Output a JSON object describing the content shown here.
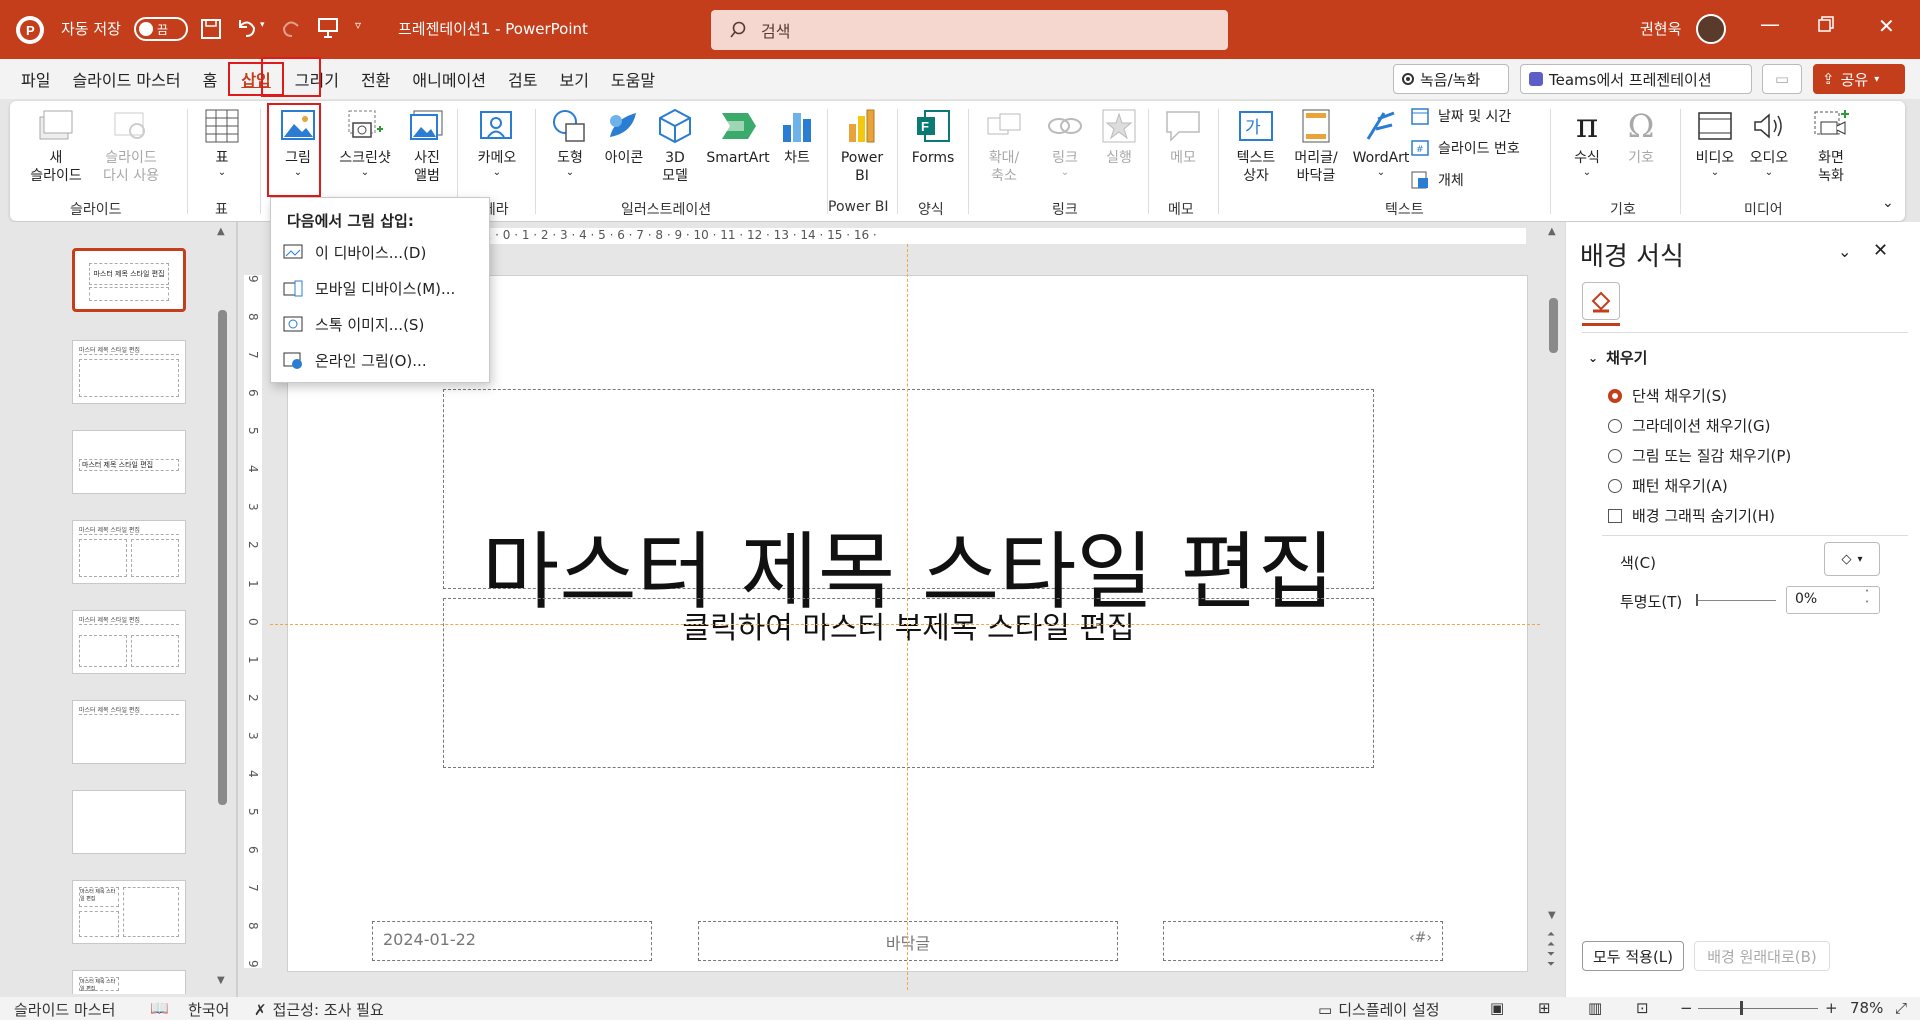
{
  "titlebar": {
    "autosave_label": "자동 저장",
    "autosave_state": "끔",
    "doc_title": "프레젠테이션1  -  PowerPoint",
    "search_placeholder": "검색",
    "user_name": "권현욱"
  },
  "menubar": {
    "items": [
      "파일",
      "슬라이드 마스터",
      "홈",
      "삽입",
      "그리기",
      "전환",
      "애니메이션",
      "검토",
      "보기",
      "도움말"
    ],
    "active": "삽입",
    "record_label": "녹음/녹화",
    "teams_label": "Teams에서 프레젠테이션",
    "share_label": "공유"
  },
  "ribbon": {
    "new_slide": "새\n슬라이드",
    "reuse_slide": "슬라이드\n다시 사용",
    "group_slide": "슬라이드",
    "table": "표",
    "group_table": "표",
    "picture": "그림",
    "screenshot": "스크린샷",
    "photo_album": "사진\n앨범",
    "cameo": "카메오",
    "group_camera": "카메라",
    "shapes": "도형",
    "icons": "아이콘",
    "model3d": "3D\n모델",
    "smartart": "SmartArt",
    "chart": "차트",
    "group_illustrations": "일러스트레이션",
    "powerbi": "Power\nBI",
    "group_powerbi": "Power BI",
    "forms": "Forms",
    "group_forms": "양식",
    "zoom": "확대/\n축소",
    "link": "링크",
    "action": "실행",
    "group_links": "링크",
    "comment": "메모",
    "group_comments": "메모",
    "textbox": "텍스트\n상자",
    "header_footer": "머리글/\n바닥글",
    "wordart": "WordArt",
    "date_time": "날짜 및 시간",
    "slide_number": "슬라이드 번호",
    "object": "개체",
    "group_text": "텍스트",
    "equation": "수식",
    "symbol": "기호",
    "group_symbols": "기호",
    "video": "비디오",
    "audio": "오디오",
    "screen_recording": "화면\n녹화",
    "group_media": "미디어"
  },
  "picture_menu": {
    "header": "다음에서 그림 삽입:",
    "items": [
      "이 디바이스...(D)",
      "모바일 디바이스(M)...",
      "스톡 이미지...(S)",
      "온라인 그림(O)..."
    ]
  },
  "thumbnails": {
    "t1": "마스터 제목 스타일 편집",
    "t2": "마스터 제목 스타일 편집",
    "t3": "마스터 제목 스타일 편집",
    "t4": "마스터 제목 스타일 편집",
    "t5": "마스터 제목 스타일 편집",
    "t6": "마스터 제목 스타일 편집",
    "t8": "마스터 제목 스타일 편집",
    "t9": "마스터 제목 스타일 편집"
  },
  "ruler": {
    "h": "· 11 · 10 · 9 · 8 · 7 · 6 · 5 · 4 · 3 · 2 · 1 · 0 · 1 · 2 · 3 · 4 · 5 · 6 · 7 · 8 · 9 · 10 · 11 · 12 · 13 · 14 · 15 · 16 ·",
    "v": [
      "9",
      "8",
      "7",
      "6",
      "5",
      "4",
      "3",
      "2",
      "1",
      "0",
      "1",
      "2",
      "3",
      "4",
      "5",
      "6",
      "7",
      "8",
      "9"
    ]
  },
  "slide": {
    "title": "마스터 제목 스타일 편집",
    "subtitle": "클릭하여 마스터 부제목 스타일 편집",
    "date": "2024-01-22",
    "footer": "바닥글",
    "slide_num": "‹#›"
  },
  "format_pane": {
    "title": "배경 서식",
    "section": "채우기",
    "options": [
      "단색 채우기(S)",
      "그라데이션 채우기(G)",
      "그림 또는 질감 채우기(P)",
      "패턴 채우기(A)"
    ],
    "hide_graphics": "배경 그래픽 숨기기(H)",
    "color_label": "색(C)",
    "transparency_label": "투명도(T)",
    "transparency_value": "0%",
    "apply_all": "모두 적용(L)",
    "reset": "배경 원래대로(B)"
  },
  "statusbar": {
    "view": "슬라이드 마스터",
    "language": "한국어",
    "accessibility": "접근성: 조사 필요",
    "display_settings": "디스플레이 설정",
    "zoom": "78%"
  },
  "colors": {
    "accent": "#c43e1c",
    "highlight": "#e01b1b"
  }
}
